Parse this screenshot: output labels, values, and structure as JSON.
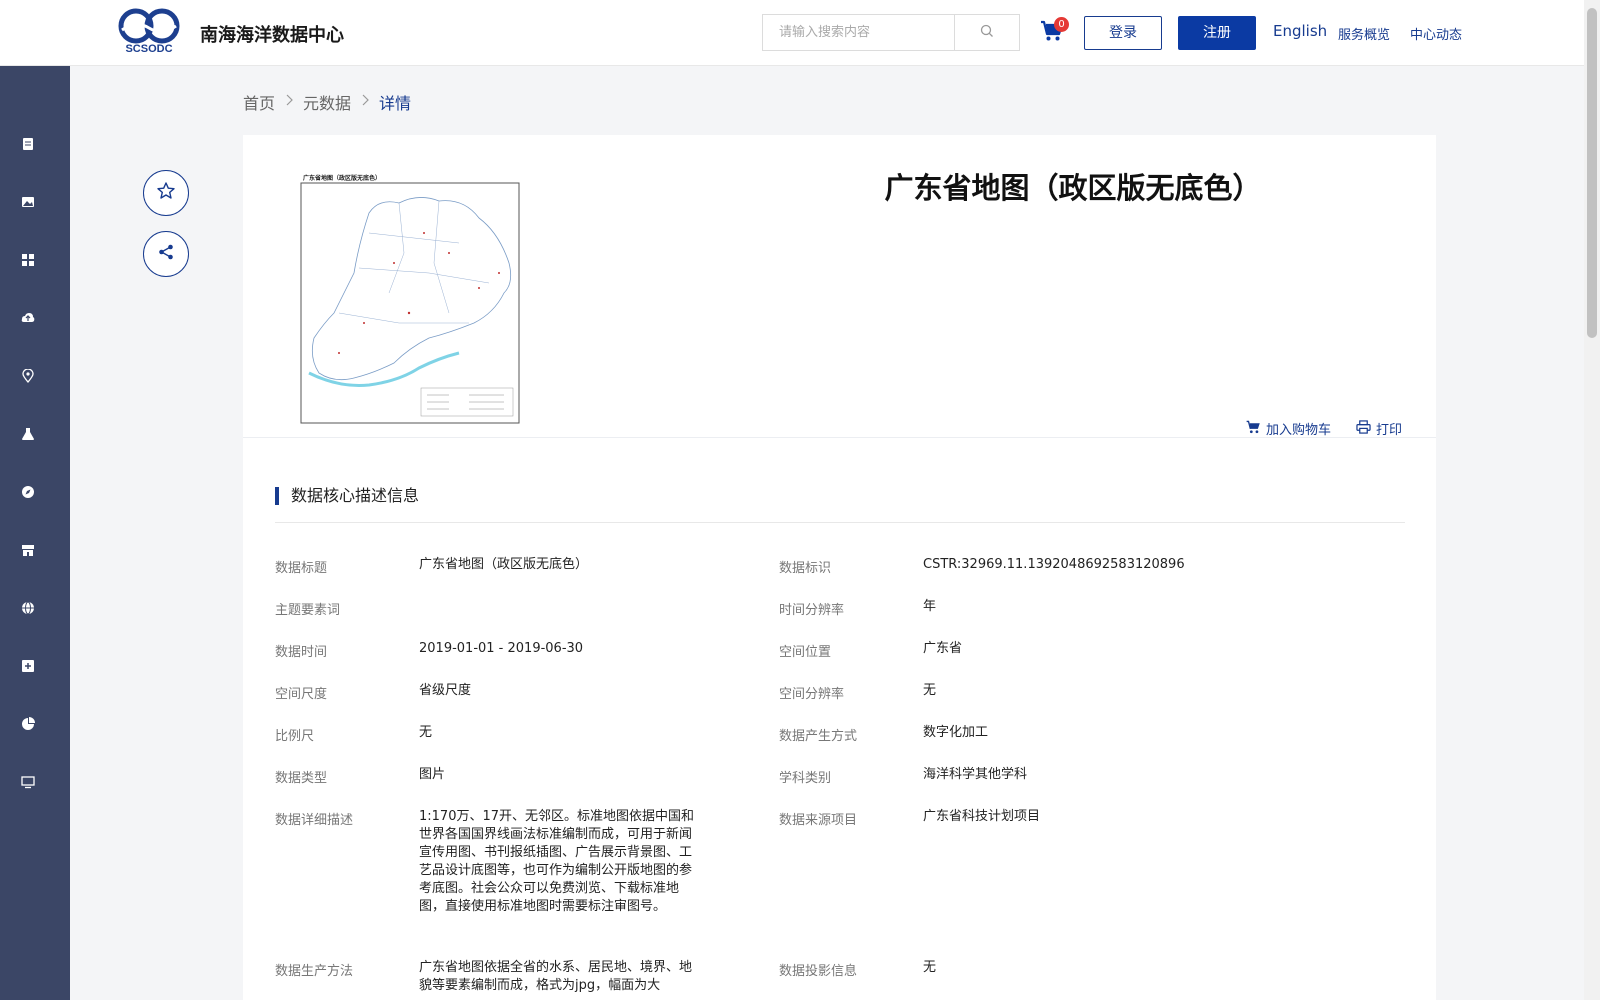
{
  "header": {
    "site_title": "南海海洋数据中心",
    "logo_text": "SCSODC",
    "search_placeholder": "请输入搜索内容",
    "cart_count": "0",
    "login_label": "登录",
    "register_label": "注册",
    "nav": {
      "english": "English",
      "overview": "服务概览",
      "news": "中心动态"
    }
  },
  "sidebar": {
    "icons": [
      "document-icon",
      "image-icon",
      "grid-icon",
      "cloud-upload-icon",
      "location-pin-icon",
      "flask-icon",
      "compass-icon",
      "store-icon",
      "globe-icon",
      "plus-square-icon",
      "pie-chart-icon",
      "monitor-icon"
    ]
  },
  "breadcrumb": {
    "home": "首页",
    "metadata": "元数据",
    "detail": "详情"
  },
  "detail": {
    "title": "广东省地图（政区版无底色）",
    "map_caption": "广东省地图（政区版无底色）",
    "add_to_cart": "加入购物车",
    "print": "打印"
  },
  "section": {
    "title": "数据核心描述信息",
    "fields_left": [
      {
        "label": "数据标题",
        "value": "广东省地图（政区版无底色）"
      },
      {
        "label": "主题要素词",
        "value": ""
      },
      {
        "label": "数据时间",
        "value": "2019-01-01 - 2019-06-30"
      },
      {
        "label": "空间尺度",
        "value": "省级尺度"
      },
      {
        "label": "比例尺",
        "value": "无"
      },
      {
        "label": "数据类型",
        "value": "图片"
      },
      {
        "label": "数据详细描述",
        "value": "1:170万、17开、无邻区。标准地图依据中国和世界各国国界线画法标准编制而成，可用于新闻宣传用图、书刊报纸插图、广告展示背景图、工艺品设计底图等，也可作为编制公开版地图的参考底图。社会公众可以免费浏览、下载标准地图，直接使用标准地图时需要标注审图号。"
      },
      {
        "label": "数据生产方法",
        "value": "广东省地图依据全省的水系、居民地、境界、地貌等要素编制而成，格式为jpg，幅面为大"
      }
    ],
    "fields_right": [
      {
        "label": "数据标识",
        "value": "CSTR:32969.11.1392048692583120896"
      },
      {
        "label": "时间分辨率",
        "value": "年"
      },
      {
        "label": "空间位置",
        "value": "广东省"
      },
      {
        "label": "空间分辨率",
        "value": "无"
      },
      {
        "label": "数据产生方式",
        "value": "数字化加工"
      },
      {
        "label": "学科类别",
        "value": "海洋科学其他学科"
      },
      {
        "label": "数据来源项目",
        "value": "广东省科技计划项目"
      },
      {
        "label": "数据投影信息",
        "value": "无"
      }
    ]
  },
  "colors": {
    "primary": "#173b8f",
    "register_bg": "#0b3aa3",
    "sidebar_bg": "#3b4666",
    "badge": "#e53935"
  }
}
